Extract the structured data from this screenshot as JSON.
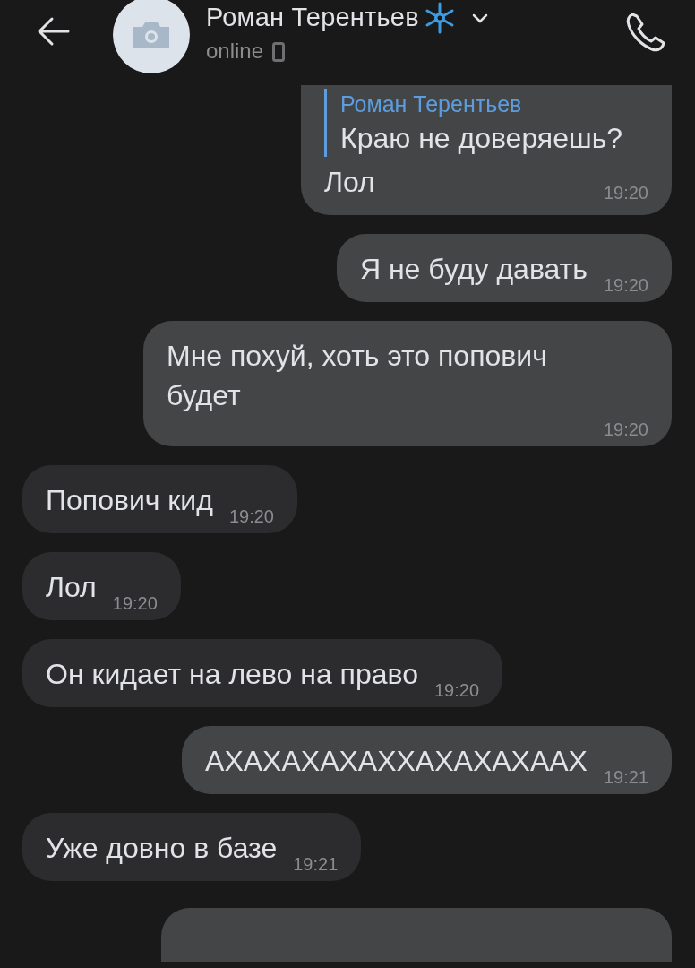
{
  "header": {
    "name": "Роман Терентьев",
    "status": "online"
  },
  "messages": [
    {
      "kind": "reply",
      "outgoing": true,
      "quote_author": "Роман Терентьев",
      "quote_text": "Краю не доверяешь?",
      "text": "Лол",
      "time": "19:20"
    },
    {
      "kind": "text",
      "outgoing": true,
      "text": "Я не буду давать",
      "time": "19:20"
    },
    {
      "kind": "text",
      "outgoing": true,
      "text": "Мне похуй, хоть это попович будет",
      "time": "19:20"
    },
    {
      "kind": "text",
      "outgoing": false,
      "text": "Попович кид",
      "time": "19:20"
    },
    {
      "kind": "text",
      "outgoing": false,
      "text": "Лол",
      "time": "19:20"
    },
    {
      "kind": "text",
      "outgoing": false,
      "text": "Он кидает на лево на право",
      "time": "19:20"
    },
    {
      "kind": "text",
      "outgoing": true,
      "text": "АХАХАХАХАХХАХАХАХААХ",
      "time": "19:21"
    },
    {
      "kind": "text",
      "outgoing": false,
      "text": "Уже довно в базе",
      "time": "19:21"
    },
    {
      "kind": "partial",
      "outgoing": true
    }
  ]
}
